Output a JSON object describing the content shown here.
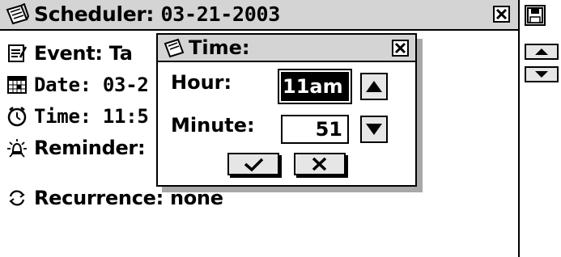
{
  "window": {
    "title_label": "Scheduler:",
    "title_date": "03-21-2003",
    "close_glyph": "✖"
  },
  "entries": [
    {
      "label": "Event: Ta",
      "icon": "notepad-icon"
    },
    {
      "label": "Date: 03-2",
      "icon": "calendar-icon"
    },
    {
      "label": "Time: 11:5",
      "icon": "clock-icon"
    },
    {
      "label": "Reminder:",
      "icon": "alarm-icon"
    },
    {
      "label": "Recurrence: none",
      "icon": "recurrence-icon"
    }
  ],
  "dialog": {
    "title": "Time:",
    "hour_label": "Hour:",
    "hour_value": "11am",
    "minute_label": "Minute:",
    "minute_value": "51",
    "ok_icon": "checkmark-icon",
    "cancel_icon": "x-icon"
  },
  "colors": {
    "titlebar": "#d4d4d4",
    "button_face": "#e6e6e6",
    "shadow": "#a8a8a8"
  }
}
